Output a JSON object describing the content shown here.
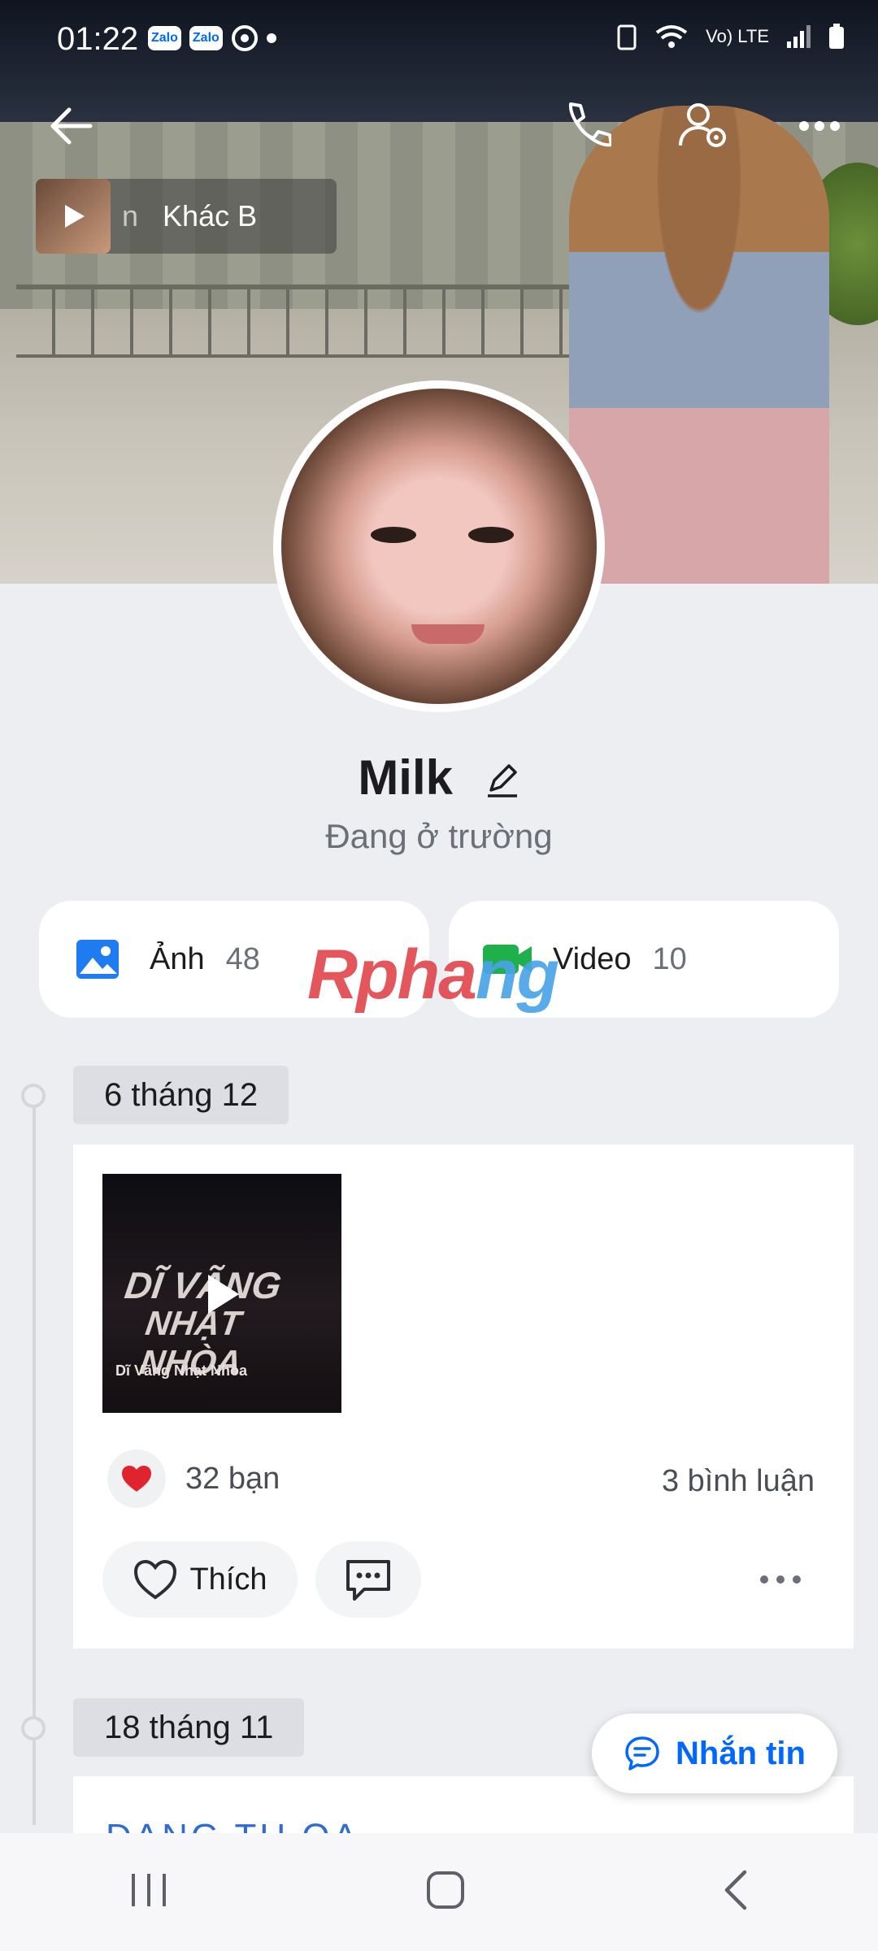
{
  "status_bar": {
    "time": "01:22",
    "app_icons": [
      "Zalo",
      "Zalo"
    ],
    "network": "Vo) LTE"
  },
  "header": {
    "music_title": "Khác B",
    "music_prefix": "n"
  },
  "profile": {
    "name": "Milk",
    "status": "Đang ở trường"
  },
  "media": {
    "photos_label": "Ảnh",
    "photos_count": "48",
    "videos_label": "Video",
    "videos_count": "10"
  },
  "watermark": {
    "part1": "Rpha",
    "part2": "ng"
  },
  "timeline": [
    {
      "date": "6 tháng 12",
      "video": {
        "title_line1": "DĨ VÃNG",
        "title_line2": "NHẠT NHÒA",
        "caption": "Dĩ Vãng Nhạt Nhòa"
      },
      "reactions": "32 bạn",
      "comments": "3 bình luận",
      "like_label": "Thích"
    },
    {
      "date": "18 tháng 11",
      "preview_text": "ĐANG TU QA"
    }
  ],
  "fab": {
    "label": "Nhắn tin"
  },
  "colors": {
    "accent": "#0068ff",
    "heart": "#e0242f",
    "video_green": "#20b04b"
  }
}
